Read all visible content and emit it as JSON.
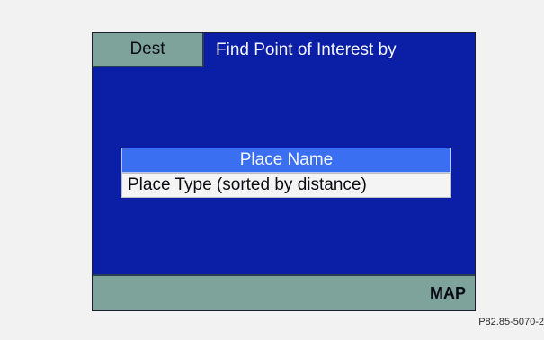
{
  "screen": {
    "dest_tab_label": "Dest",
    "title": "Find Point of Interest by",
    "options": [
      {
        "label": "Place Name",
        "selected": true
      },
      {
        "label": "Place Type (sorted by distance)",
        "selected": false
      }
    ],
    "map_button_label": "MAP"
  },
  "figure_code": "P82.85-5070-2",
  "colors": {
    "screen_background": "#0a1fa6",
    "tab_bar": "#7ea39b",
    "selected_option": "#3b6ff2"
  }
}
